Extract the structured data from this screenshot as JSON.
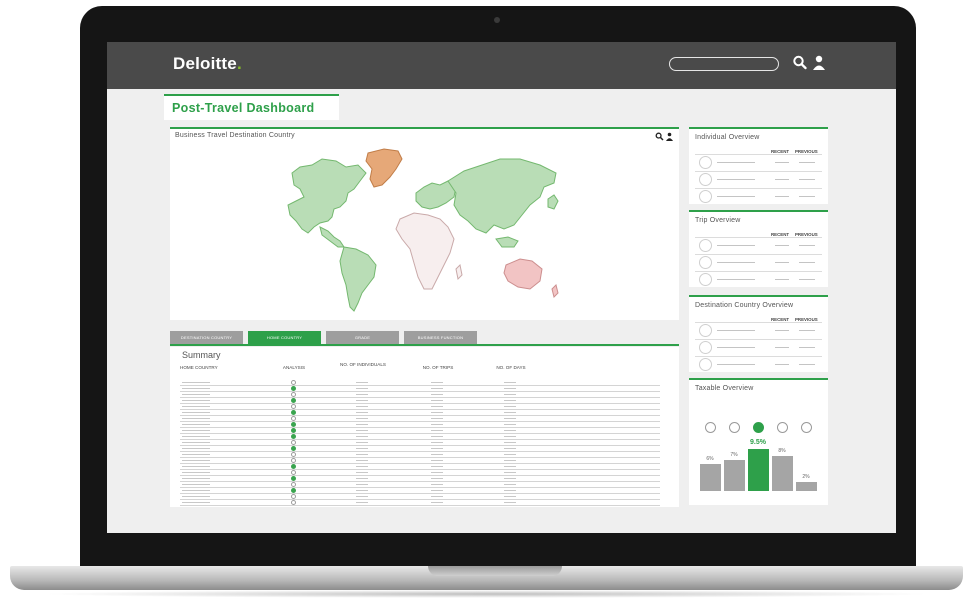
{
  "brand": {
    "name": "Deloitte",
    "dot": "."
  },
  "header": {
    "search_placeholder": "",
    "search_icon": "search-icon",
    "user_icon": "user-icon"
  },
  "page_title": "Post-Travel Dashboard",
  "map_panel": {
    "title": "Business Travel Destination Country",
    "icons": [
      "search-icon",
      "user-icon"
    ],
    "highlight_colors": {
      "high": "#b9ddb6",
      "mid": "#e6a878",
      "low": "#f2c4c4",
      "neutral": "#f7eeee"
    }
  },
  "tabs": [
    {
      "label": "DESTINATION COUNTRY",
      "active": false
    },
    {
      "label": "HOME COUNTRY",
      "active": true
    },
    {
      "label": "GRADE",
      "active": false
    },
    {
      "label": "BUSINESS FUNCTION",
      "active": false
    }
  ],
  "summary": {
    "title": "Summary",
    "columns": [
      "HOME COUNTRY",
      "ANALYSIS",
      "NO. OF INDIVIDUALS",
      "NO. OF TRIPS",
      "NO. OF DAYS"
    ],
    "analysis_flags": [
      false,
      true,
      false,
      true,
      false,
      true,
      false,
      true,
      true,
      true,
      false,
      true,
      false,
      false,
      true,
      false,
      true,
      false,
      true,
      false,
      false
    ]
  },
  "side_panels": [
    {
      "title": "Individual Overview",
      "col_recent": "RECENT",
      "col_previous": "PREVIOUS"
    },
    {
      "title": "Trip Overview",
      "col_recent": "RECENT",
      "col_previous": "PREVIOUS"
    },
    {
      "title": "Destination Country Overview",
      "col_recent": "RECENT",
      "col_previous": "PREVIOUS"
    }
  ],
  "taxable": {
    "title": "Taxable Overview",
    "bars": [
      {
        "label": "6%",
        "value": 6,
        "active": false
      },
      {
        "label": "7%",
        "value": 7,
        "active": false
      },
      {
        "label": "9.5%",
        "value": 9.5,
        "active": true
      },
      {
        "label": "8%",
        "value": 8,
        "active": false
      },
      {
        "label": "2%",
        "value": 2,
        "active": false
      }
    ],
    "colors": {
      "active": "#2ea04a",
      "inactive": "#a5a5a5"
    }
  },
  "accent_color": "#2ea04a"
}
